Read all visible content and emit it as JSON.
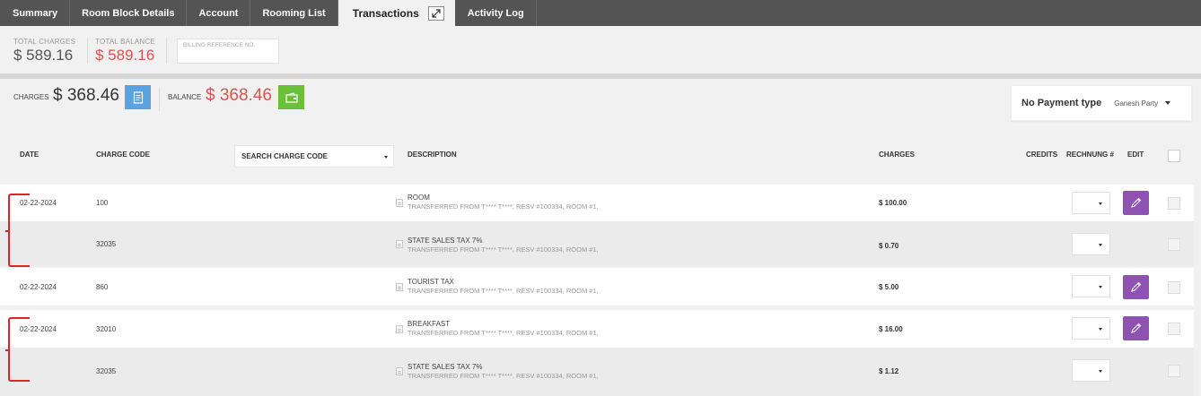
{
  "tabs": [
    {
      "label": "Summary",
      "active": false
    },
    {
      "label": "Room Block Details",
      "active": false
    },
    {
      "label": "Account",
      "active": false
    },
    {
      "label": "Rooming List",
      "active": false
    },
    {
      "label": "Transactions",
      "active": true
    },
    {
      "label": "Activity Log",
      "active": false
    }
  ],
  "totals": {
    "total_charges_label": "TOTAL CHARGES",
    "total_charges_value": "$ 589.16",
    "total_balance_label": "TOTAL BALANCE",
    "total_balance_value": "$ 589.16",
    "billing_reference_placeholder": "BILLING REFERENCE NO."
  },
  "summary": {
    "charges_label": "CHARGES",
    "charges_value": "$ 368.46",
    "balance_label": "BALANCE",
    "balance_value": "$ 368.46"
  },
  "payment": {
    "type_label": "No Payment type",
    "party_name": "Ganesh Party"
  },
  "header": {
    "date": "DATE",
    "charge_code": "CHARGE CODE",
    "search_charge_code": "SEARCH CHARGE CODE",
    "description": "DESCRIPTION",
    "charges": "CHARGES",
    "credits": "CREDITS",
    "rechnung": "RECHNUNG #",
    "edit": "EDIT"
  },
  "rows": [
    {
      "date": "02-22-2024",
      "code": "100",
      "title": "ROOM",
      "sub": "TRANSFERRED FROM T**** T****, RESV #100334, ROOM #1,",
      "amount": "$ 100.00",
      "editable": true
    },
    {
      "date": "",
      "code": "32035",
      "title": "STATE SALES TAX 7%",
      "sub": "TRANSFERRED FROM T**** T****, RESV #100334, ROOM #1,",
      "amount": "$ 0.70",
      "editable": false
    },
    {
      "date": "02-22-2024",
      "code": "860",
      "title": "TOURIST TAX",
      "sub": "TRANSFERRED FROM T**** T****, RESV #100334, ROOM #1,",
      "amount": "$ 5.00",
      "editable": true
    },
    {
      "date": "02-22-2024",
      "code": "32010",
      "title": "BREAKFAST",
      "sub": "TRANSFERRED FROM T**** T****, RESV #100334, ROOM #1,",
      "amount": "$ 16.00",
      "editable": true
    },
    {
      "date": "",
      "code": "32035",
      "title": "STATE SALES TAX 7%",
      "sub": "TRANSFERRED FROM T**** T****, RESV #100334, ROOM #1,",
      "amount": "$ 1.12",
      "editable": false
    }
  ],
  "colors": {
    "accent_red": "#d9534f",
    "edit_purple": "#8f52b3",
    "blue_button": "#5ba3e0",
    "green_button": "#6ac03a",
    "annotation_red": "#d9262c"
  },
  "icons": {
    "popout": "expand-icon",
    "charges_button": "invoice-icon",
    "balance_button": "wallet-icon",
    "edit": "pencil-icon",
    "description_note": "note-icon"
  }
}
